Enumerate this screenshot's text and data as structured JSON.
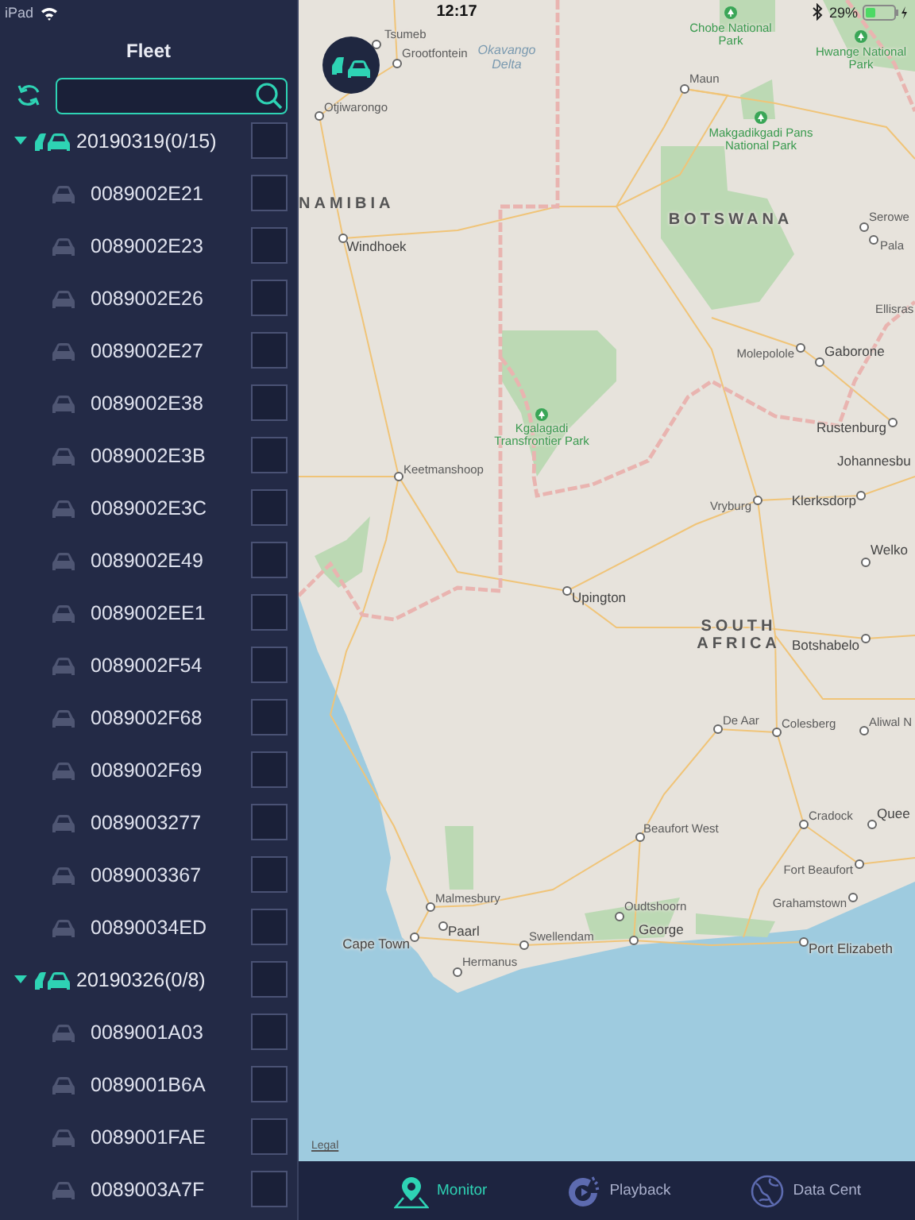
{
  "status_bar": {
    "device": "iPad",
    "time": "12:17",
    "battery": "29%"
  },
  "sidebar": {
    "title": "Fleet",
    "groups": [
      {
        "name": "20190319(0/15)",
        "expanded": true,
        "checked": false,
        "children": [
          {
            "name": "0089002E21",
            "online": false,
            "checked": false
          },
          {
            "name": "0089002E23",
            "online": false,
            "checked": false
          },
          {
            "name": "0089002E26",
            "online": false,
            "checked": false
          },
          {
            "name": "0089002E27",
            "online": false,
            "checked": false
          },
          {
            "name": "0089002E38",
            "online": false,
            "checked": false
          },
          {
            "name": "0089002E3B",
            "online": false,
            "checked": false
          },
          {
            "name": "0089002E3C",
            "online": false,
            "checked": false
          },
          {
            "name": "0089002E49",
            "online": false,
            "checked": false
          },
          {
            "name": "0089002EE1",
            "online": false,
            "checked": false
          },
          {
            "name": "0089002F54",
            "online": false,
            "checked": false
          },
          {
            "name": "0089002F68",
            "online": false,
            "checked": false
          },
          {
            "name": "0089002F69",
            "online": false,
            "checked": false
          },
          {
            "name": "0089003277",
            "online": false,
            "checked": false
          },
          {
            "name": "0089003367",
            "online": false,
            "checked": false
          },
          {
            "name": "00890034ED",
            "online": false,
            "checked": false
          }
        ]
      },
      {
        "name": "20190326(0/8)",
        "expanded": true,
        "checked": false,
        "children": [
          {
            "name": "0089001A03",
            "online": false,
            "checked": false
          },
          {
            "name": "0089001B6A",
            "online": false,
            "checked": false
          },
          {
            "name": "0089001FAE",
            "online": false,
            "checked": false
          },
          {
            "name": "0089003A7F",
            "online": false,
            "checked": false
          }
        ]
      }
    ]
  },
  "map": {
    "places": [
      {
        "name": "Tsumeb",
        "kind": "city"
      },
      {
        "name": "Grootfontein",
        "kind": "city"
      },
      {
        "name": "Otjiwarongo",
        "kind": "city"
      },
      {
        "name": "NAMIBIA",
        "kind": "country"
      },
      {
        "name": "Windhoek",
        "kind": "major-city"
      },
      {
        "name": "Okavango Delta",
        "kind": "water"
      },
      {
        "name": "Chobe National Park",
        "kind": "park"
      },
      {
        "name": "Maun",
        "kind": "city"
      },
      {
        "name": "Hwange National Park",
        "kind": "park"
      },
      {
        "name": "Makgadikgadi Pans National Park",
        "kind": "park"
      },
      {
        "name": "BOTSWANA",
        "kind": "country"
      },
      {
        "name": "Serowe",
        "kind": "city"
      },
      {
        "name": "Pala",
        "kind": "city"
      },
      {
        "name": "Ellisras",
        "kind": "city"
      },
      {
        "name": "Molepolole",
        "kind": "city"
      },
      {
        "name": "Gaborone",
        "kind": "major-city"
      },
      {
        "name": "Kgalagadi Transfrontier Park",
        "kind": "park"
      },
      {
        "name": "Rustenburg",
        "kind": "major-city"
      },
      {
        "name": "Johannesbu",
        "kind": "major-city"
      },
      {
        "name": "Keetmanshoop",
        "kind": "city"
      },
      {
        "name": "Vryburg",
        "kind": "city"
      },
      {
        "name": "Klerksdorp",
        "kind": "major-city"
      },
      {
        "name": "Welko",
        "kind": "major-city"
      },
      {
        "name": "Upington",
        "kind": "major-city"
      },
      {
        "name": "SOUTH AFRICA",
        "kind": "country"
      },
      {
        "name": "Botshabelo",
        "kind": "major-city"
      },
      {
        "name": "De Aar",
        "kind": "city"
      },
      {
        "name": "Colesberg",
        "kind": "city"
      },
      {
        "name": "Aliwal N",
        "kind": "city"
      },
      {
        "name": "Beaufort West",
        "kind": "city"
      },
      {
        "name": "Cradock",
        "kind": "city"
      },
      {
        "name": "Quee",
        "kind": "major-city"
      },
      {
        "name": "Fort Beaufort",
        "kind": "city"
      },
      {
        "name": "Malmesbury",
        "kind": "city"
      },
      {
        "name": "Oudtshoorn",
        "kind": "city"
      },
      {
        "name": "Grahamstown",
        "kind": "city"
      },
      {
        "name": "Paarl",
        "kind": "major-city"
      },
      {
        "name": "Cape Town",
        "kind": "major-city"
      },
      {
        "name": "Swellendam",
        "kind": "city"
      },
      {
        "name": "George",
        "kind": "major-city"
      },
      {
        "name": "Port Elizabeth",
        "kind": "major-city"
      },
      {
        "name": "Hermanus",
        "kind": "city"
      }
    ],
    "legal": "Legal"
  },
  "tabs": [
    {
      "label": "Monitor",
      "kind": "pin",
      "selected": true
    },
    {
      "label": "Playback",
      "kind": "replay",
      "selected": false
    },
    {
      "label": "Data Cent",
      "kind": "globe",
      "selected": false
    }
  ]
}
